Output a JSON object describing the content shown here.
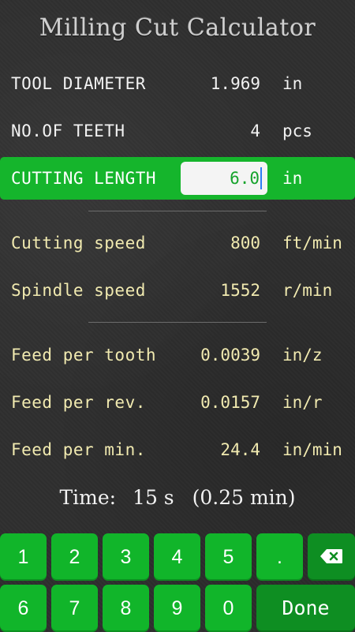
{
  "app": {
    "title": "Milling Cut Calculator"
  },
  "inputs": [
    {
      "label": "TOOL DIAMETER",
      "value": "1.969",
      "unit": "in"
    },
    {
      "label": "NO.OF TEETH",
      "value": "4",
      "unit": "pcs"
    }
  ],
  "active_input": {
    "label": "CUTTING LENGTH",
    "value": "6.0",
    "unit": "in"
  },
  "speeds": [
    {
      "label": "Cutting speed",
      "value": "800",
      "unit": "ft/min"
    },
    {
      "label": "Spindle speed",
      "value": "1552",
      "unit": "r/min"
    }
  ],
  "feeds": [
    {
      "label": "Feed per tooth",
      "value": "0.0039",
      "unit": "in/z"
    },
    {
      "label": "Feed per rev.",
      "value": "0.0157",
      "unit": "in/r"
    },
    {
      "label": "Feed per min.",
      "value": "24.4",
      "unit": "in/min"
    }
  ],
  "time": {
    "label": "Time:",
    "seconds": "15 s",
    "minutes": "(0.25 min)"
  },
  "keypad": {
    "row1": [
      "1",
      "2",
      "3",
      "4",
      "5",
      "."
    ],
    "row2": [
      "6",
      "7",
      "8",
      "9",
      "0"
    ],
    "done_label": "Done",
    "backspace_icon": "backspace-icon"
  },
  "colors": {
    "accent_green": "#15b52c",
    "value_yellow": "#f1eab0",
    "background": "#2f2f2f"
  }
}
